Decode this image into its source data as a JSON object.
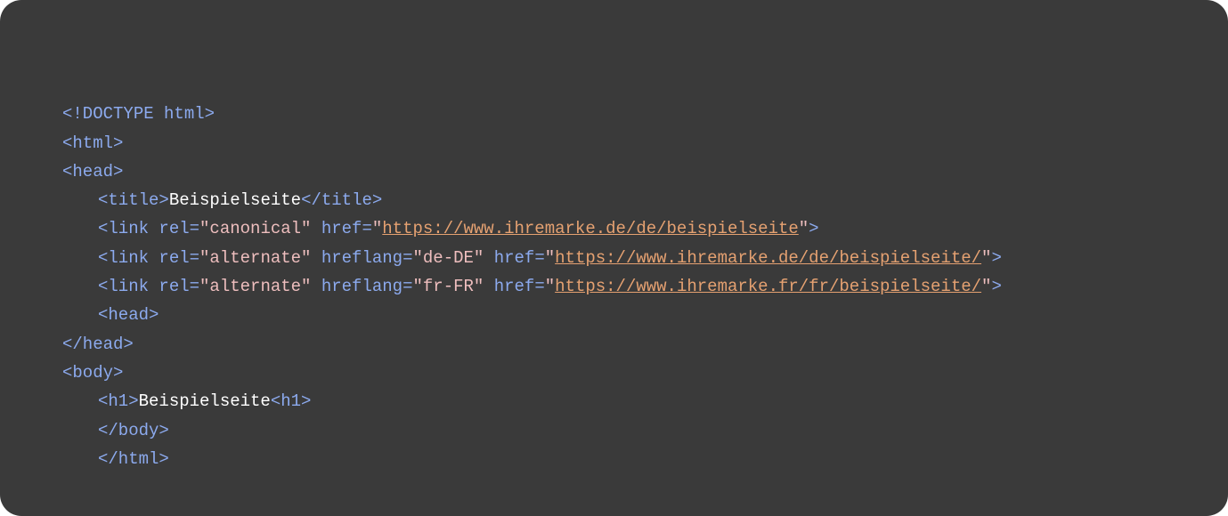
{
  "code": {
    "line1": {
      "tag": "<!DOCTYPE html>"
    },
    "line2": {
      "tag": "<html>"
    },
    "line3": {
      "tag": "<head>"
    },
    "line4": {
      "open": "<title>",
      "text": "Beispielseite",
      "close": "</title>"
    },
    "line5": {
      "p1": "<link ",
      "p2": "rel=",
      "p3": "\"canonical\"",
      "p4": " href=",
      "p5": "\"",
      "url": "https://www.ihremarke.de/de/beispielseite",
      "p7": "\"",
      "p8": ">"
    },
    "line6": {
      "p1": "<link ",
      "p2": "rel=",
      "p3": "\"alternate\"",
      "p4": " hreflang=",
      "p5": "\"de-DE\"",
      "p6": " href=",
      "p7": "\"",
      "url": "https://www.ihremarke.de/de/beispielseite/",
      "p9": "\"",
      "p10": ">"
    },
    "line7": {
      "p1": "<link ",
      "p2": "rel=",
      "p3": "\"alternate\"",
      "p4": " hreflang=",
      "p5": "\"fr-FR\"",
      "p6": " href=",
      "p7": "\"",
      "url": "https://www.ihremarke.fr/fr/beispielseite/",
      "p9": "\"",
      "p10": ">"
    },
    "line8": {
      "tag": "<head>"
    },
    "line9": {
      "tag": "</head>"
    },
    "line10": {
      "tag": "<body>"
    },
    "line11": {
      "open": "<h1>",
      "text": "Beispielseite",
      "close": "<h1>"
    },
    "line12": {
      "tag": "</body>"
    },
    "line13": {
      "tag": "</html>"
    }
  }
}
